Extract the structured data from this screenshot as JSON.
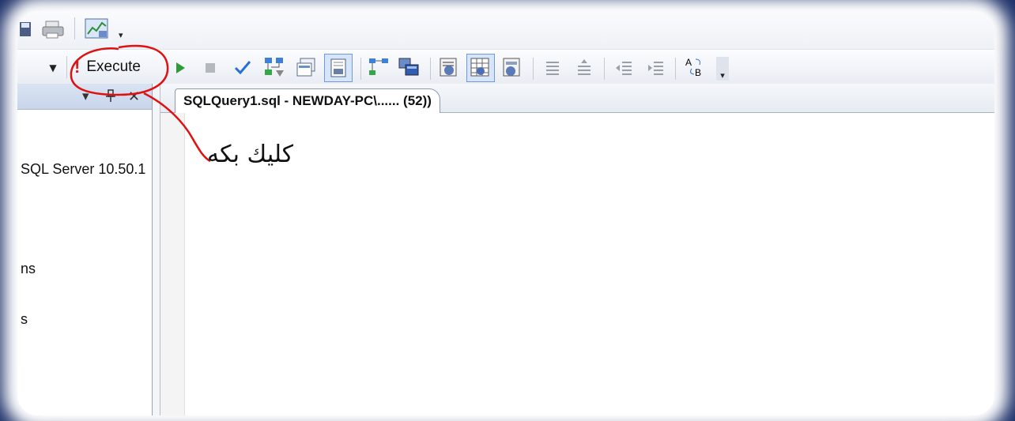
{
  "toolbar_top": {
    "icons": [
      "save-icon",
      "print-icon",
      "chart-icon",
      "overflow-chevron-icon"
    ]
  },
  "toolbar_sql": {
    "execute_label": "Execute",
    "icons": [
      "dropdown-arrow-icon",
      "execute-icon",
      "debug-run-icon",
      "stop-icon",
      "parse-checkmark-icon",
      "display-plan-icon",
      "query-designer-icon",
      "specify-values-icon",
      "include-plan-icon",
      "client-stats-icon",
      "results-text-icon",
      "results-grid-icon",
      "results-file-icon",
      "comment-icon",
      "uncomment-icon",
      "decrease-indent-icon",
      "increase-indent-icon",
      "specify-template-icon",
      "overflow-chevron-icon"
    ]
  },
  "object_explorer": {
    "server_node": "SQL Server 10.50.1",
    "node_2": "ns",
    "node_3": "s"
  },
  "document_tab": {
    "title": "SQLQuery1.sql - NEWDAY-PC\\...... (52))"
  },
  "annotation": {
    "text": "كليك بكه",
    "color": "#e01010"
  },
  "colors": {
    "frame": "#0a1f5c",
    "accent_blue": "#2a6fd6"
  }
}
